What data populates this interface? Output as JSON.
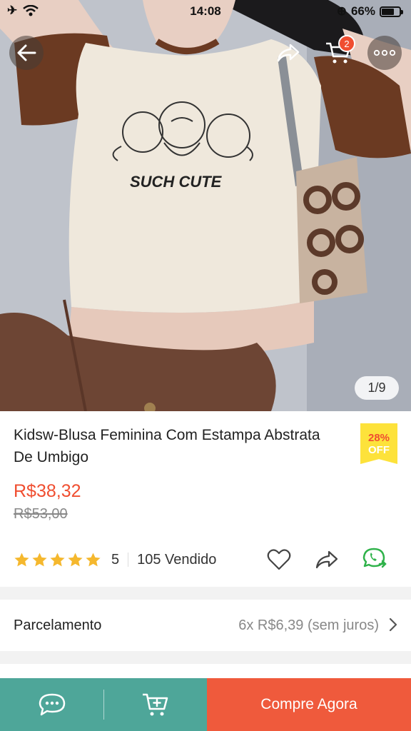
{
  "status": {
    "time": "14:08",
    "battery": "66%"
  },
  "hero": {
    "image_desc": "product-photo",
    "print_text": "SUCH CUTE",
    "counter": "1/9",
    "cart_count": "2"
  },
  "product": {
    "title": "Kidsw-Blusa Feminina Com Estampa Abstrata De Umbigo",
    "discount_pct": "28%",
    "discount_off": "OFF",
    "price": "R$38,32",
    "old_price": "R$53,00",
    "rating": "5",
    "sold": "105 Vendido",
    "stars": 5
  },
  "installments": {
    "label": "Parcelamento",
    "value": "6x R$6,39 (sem juros)"
  },
  "bottom_bar": {
    "buy_label": "Compre Agora"
  },
  "colors": {
    "accent": "#f04e30",
    "teal": "#4ea699",
    "buy": "#ef5a3c",
    "badge_yellow": "#fde23b"
  },
  "icons": [
    "back-arrow-icon",
    "share-icon",
    "cart-icon",
    "more-icon",
    "star-icon",
    "heart-icon",
    "whatsapp-icon",
    "chat-icon",
    "add-to-cart-icon",
    "chevron-right-icon"
  ]
}
